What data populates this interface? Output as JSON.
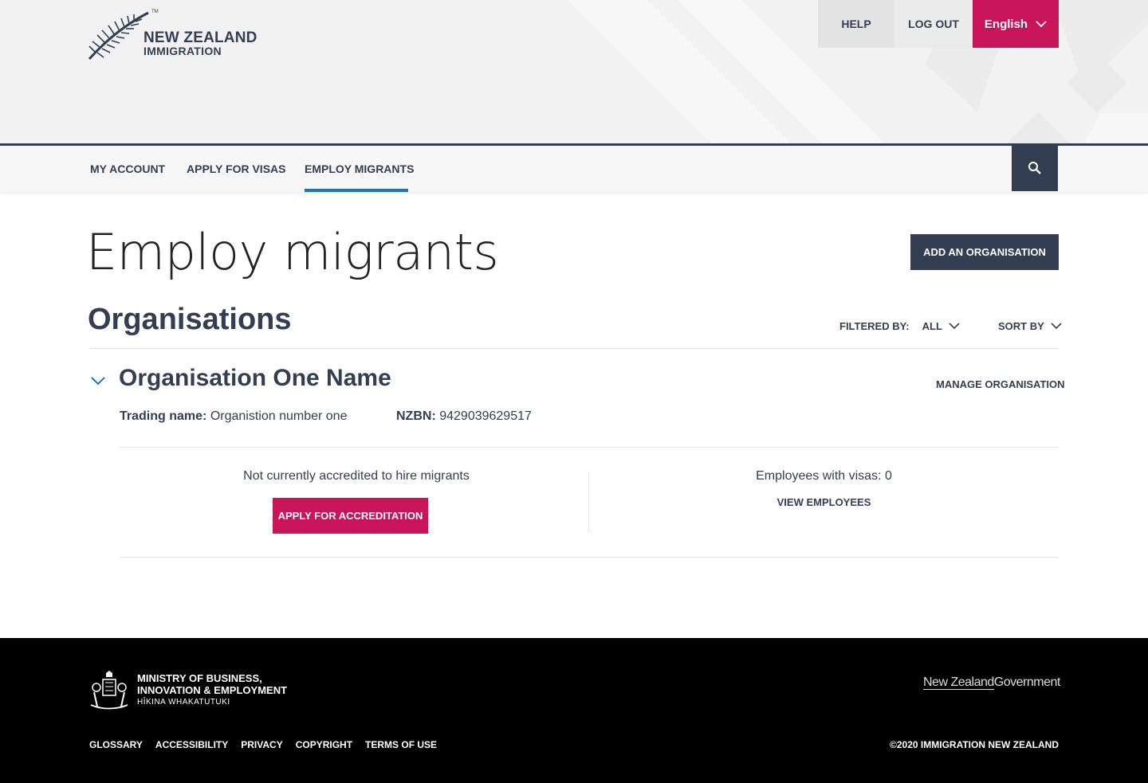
{
  "header": {
    "logo": {
      "line1": "NEW ZEALAND",
      "line2": "IMMIGRATION",
      "tm": "TM"
    },
    "links": {
      "help": "HELP",
      "logout": "LOG OUT",
      "language": "English"
    }
  },
  "nav": {
    "items": [
      {
        "label": "MY ACCOUNT"
      },
      {
        "label": "APPLY FOR VISAS"
      },
      {
        "label": "EMPLOY MIGRANTS",
        "active": true
      }
    ],
    "search_icon": "search-icon"
  },
  "main": {
    "title": "Employ migrants",
    "add_org_button": "ADD AN ORGANISATION",
    "section_title": "Organisations",
    "filter": {
      "label": "FILTERED BY:",
      "value": "ALL"
    },
    "sort": {
      "label": "SORT BY"
    },
    "organisation": {
      "name": "Organisation One Name",
      "manage_link": "MANAGE ORGANISATION",
      "trading_name_label": "Trading name:",
      "trading_name_value": "Organistion number one",
      "nzbn_label": "NZBN:",
      "nzbn_value": "9429039629517",
      "accreditation_status": "Not currently accredited to hire migrants",
      "apply_accreditation_button": "APPLY FOR ACCREDITATION",
      "employees_text": "Employees with visas: 0",
      "view_employees_link": "VIEW EMPLOYEES"
    }
  },
  "footer": {
    "mbie": {
      "line1": "MINISTRY OF BUSINESS,",
      "line2": "INNOVATION & EMPLOYMENT",
      "line3": "HĪKINA WHAKATUTUKI"
    },
    "nzgov": {
      "part1": "New Zealand",
      "part2": "Government"
    },
    "links": [
      "GLOSSARY",
      "ACCESSIBILITY",
      "PRIVACY",
      "COPYRIGHT",
      "TERMS OF USE"
    ],
    "copyright": "©2020 IMMIGRATION NEW ZEALAND"
  },
  "colors": {
    "brand_navy": "#343e52",
    "brand_magenta": "#c8155a",
    "active_blue": "#1a77be"
  }
}
